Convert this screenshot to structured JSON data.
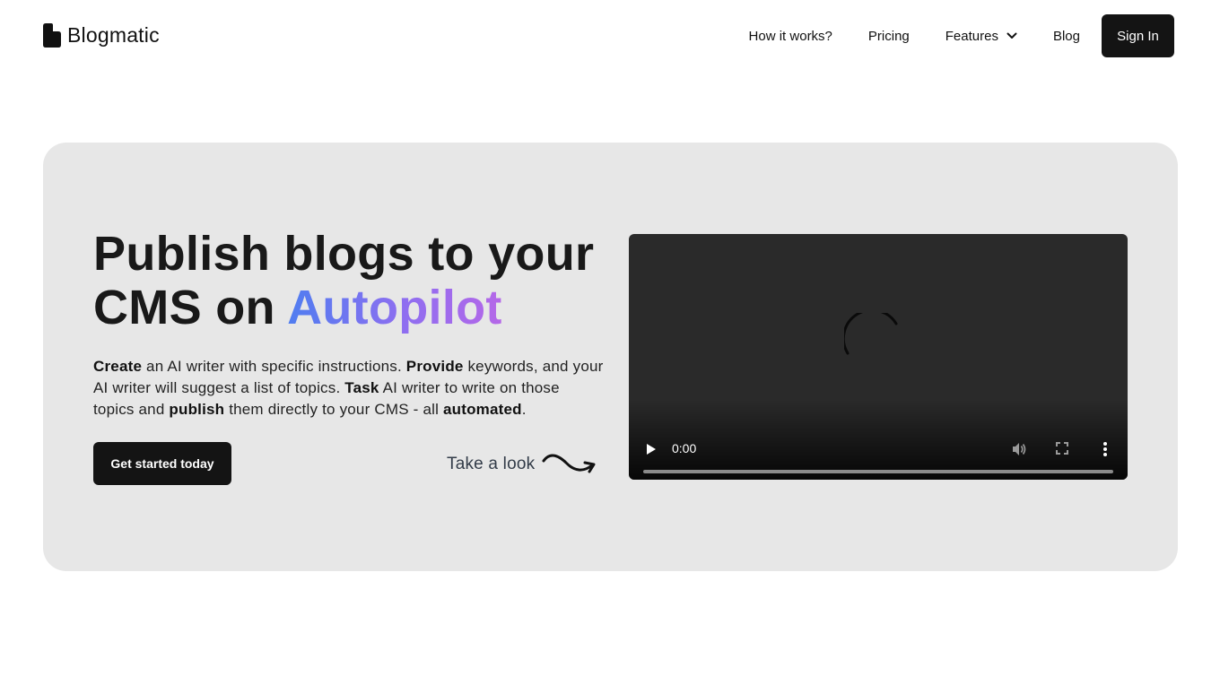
{
  "header": {
    "brand": "Blogmatic",
    "nav": [
      {
        "label": "How it works?"
      },
      {
        "label": "Pricing"
      },
      {
        "label": "Features"
      },
      {
        "label": "Blog"
      }
    ],
    "signin_label": "Sign In"
  },
  "hero": {
    "headline_part1": "Publish blogs to your CMS on ",
    "headline_accent": "Autopilot",
    "accent_gradient": [
      "#4f7df0",
      "#8f6ef0",
      "#b567e8"
    ],
    "description": [
      {
        "text": "Create",
        "bold": true
      },
      {
        "text": " an AI writer with specific instructions. ",
        "bold": false
      },
      {
        "text": "Provide",
        "bold": true
      },
      {
        "text": " keywords, and your AI writer will suggest a list of topics. ",
        "bold": false
      },
      {
        "text": "Task",
        "bold": true
      },
      {
        "text": " AI writer to write on those topics and ",
        "bold": false
      },
      {
        "text": "publish",
        "bold": true
      },
      {
        "text": " them directly to your CMS - all ",
        "bold": false
      },
      {
        "text": "automated",
        "bold": true
      },
      {
        "text": ".",
        "bold": false
      }
    ],
    "cta_label": "Get started today",
    "look_label": "Take a look"
  },
  "video": {
    "time": "0:00",
    "progress": 0,
    "icons": [
      "play-icon",
      "volume-icon",
      "fullscreen-icon",
      "more-vertical-icon",
      "loading-spinner"
    ]
  },
  "colors": {
    "button_bg": "#141414",
    "hero_bg": "#e7e7e7",
    "video_bg": "#2a2a2a"
  }
}
